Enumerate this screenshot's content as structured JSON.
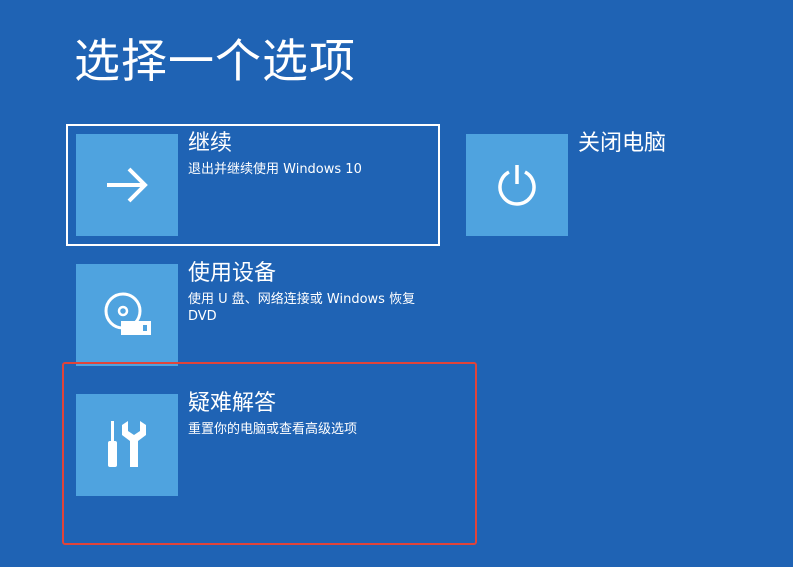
{
  "page": {
    "title": "选择一个选项"
  },
  "options": [
    {
      "id": "continue",
      "title": "继续",
      "description": "退出并继续使用 Windows 10",
      "icon": "arrow-right-icon",
      "focused": true
    },
    {
      "id": "shutdown",
      "title": "关闭电脑",
      "description": "",
      "icon": "power-icon",
      "focused": false
    },
    {
      "id": "use-device",
      "title": "使用设备",
      "description": "使用 U 盘、网络连接或 Windows 恢复 DVD",
      "icon": "disc-drive-icon",
      "focused": false
    },
    {
      "id": "troubleshoot",
      "title": "疑难解答",
      "description": "重置你的电脑或查看高级选项",
      "icon": "tools-icon",
      "focused": false,
      "highlighted": true
    }
  ],
  "colors": {
    "background": "#1f63b4",
    "tile": "#4fa3df",
    "text": "#ffffff",
    "focus_border": "#ffffff",
    "highlight_border": "#e0443a"
  }
}
